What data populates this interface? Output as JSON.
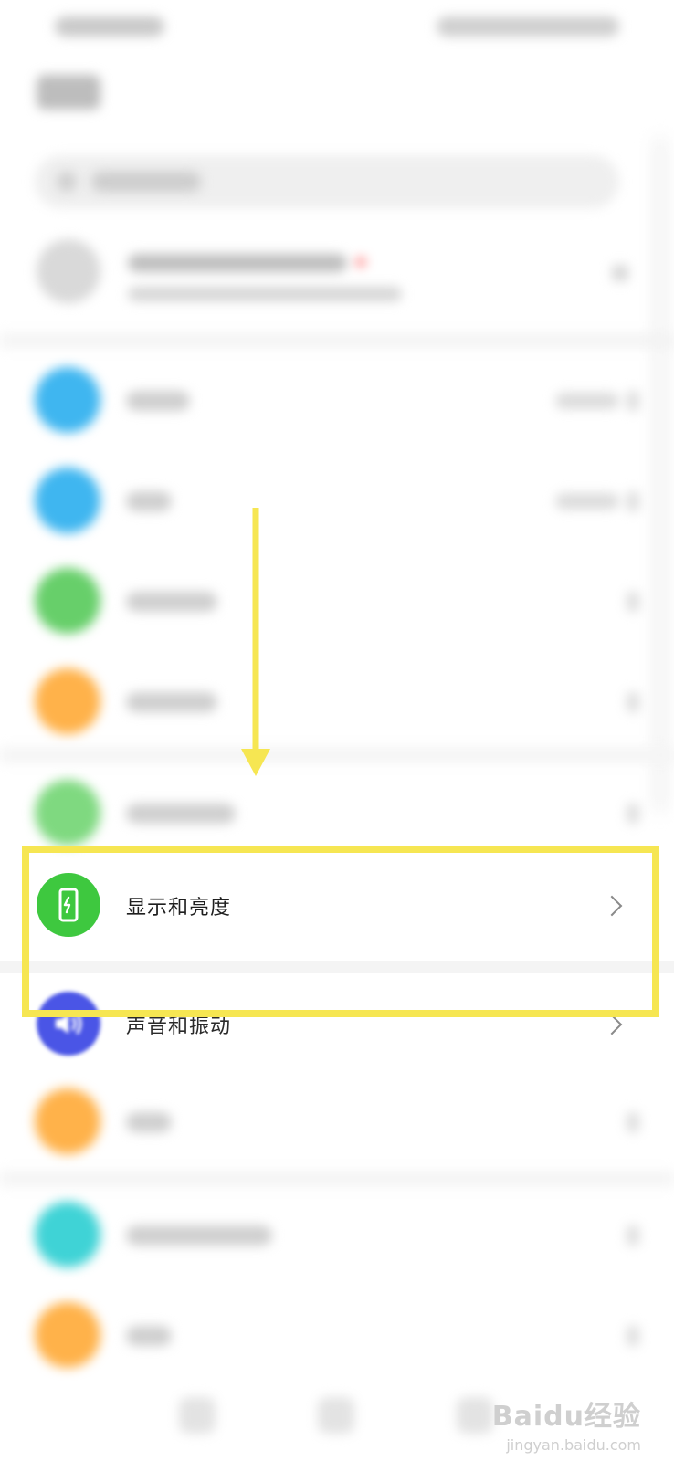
{
  "highlighted_item": {
    "label": "显示和亮度"
  },
  "next_item": {
    "label": "声音和振动"
  },
  "blurred_rows": [
    {
      "icon_color": "#3fb6f0",
      "label_width": 70,
      "has_value": true
    },
    {
      "icon_color": "#3fb6f0",
      "label_width": 50,
      "has_value": true
    },
    {
      "icon_color": "#67cf6a",
      "label_width": 100,
      "has_value": false
    },
    {
      "icon_color": "#ffb24a",
      "label_width": 100,
      "has_value": false
    },
    {
      "icon_color": "#7fd980",
      "label_width": 120,
      "has_value": false
    }
  ],
  "lower_rows": [
    {
      "icon_color": "#ffb24a",
      "label_width": 50
    },
    {
      "icon_color": "#3fd3d6",
      "label_width": 160
    },
    {
      "icon_color": "#ffb24a",
      "label_width": 50
    }
  ],
  "watermark": {
    "brand": "Baidu经验",
    "url": "jingyan.baidu.com"
  },
  "colors": {
    "display_icon": "#3ec83f",
    "sound_icon": "#4a55e6",
    "highlight_box": "#f6e652"
  }
}
